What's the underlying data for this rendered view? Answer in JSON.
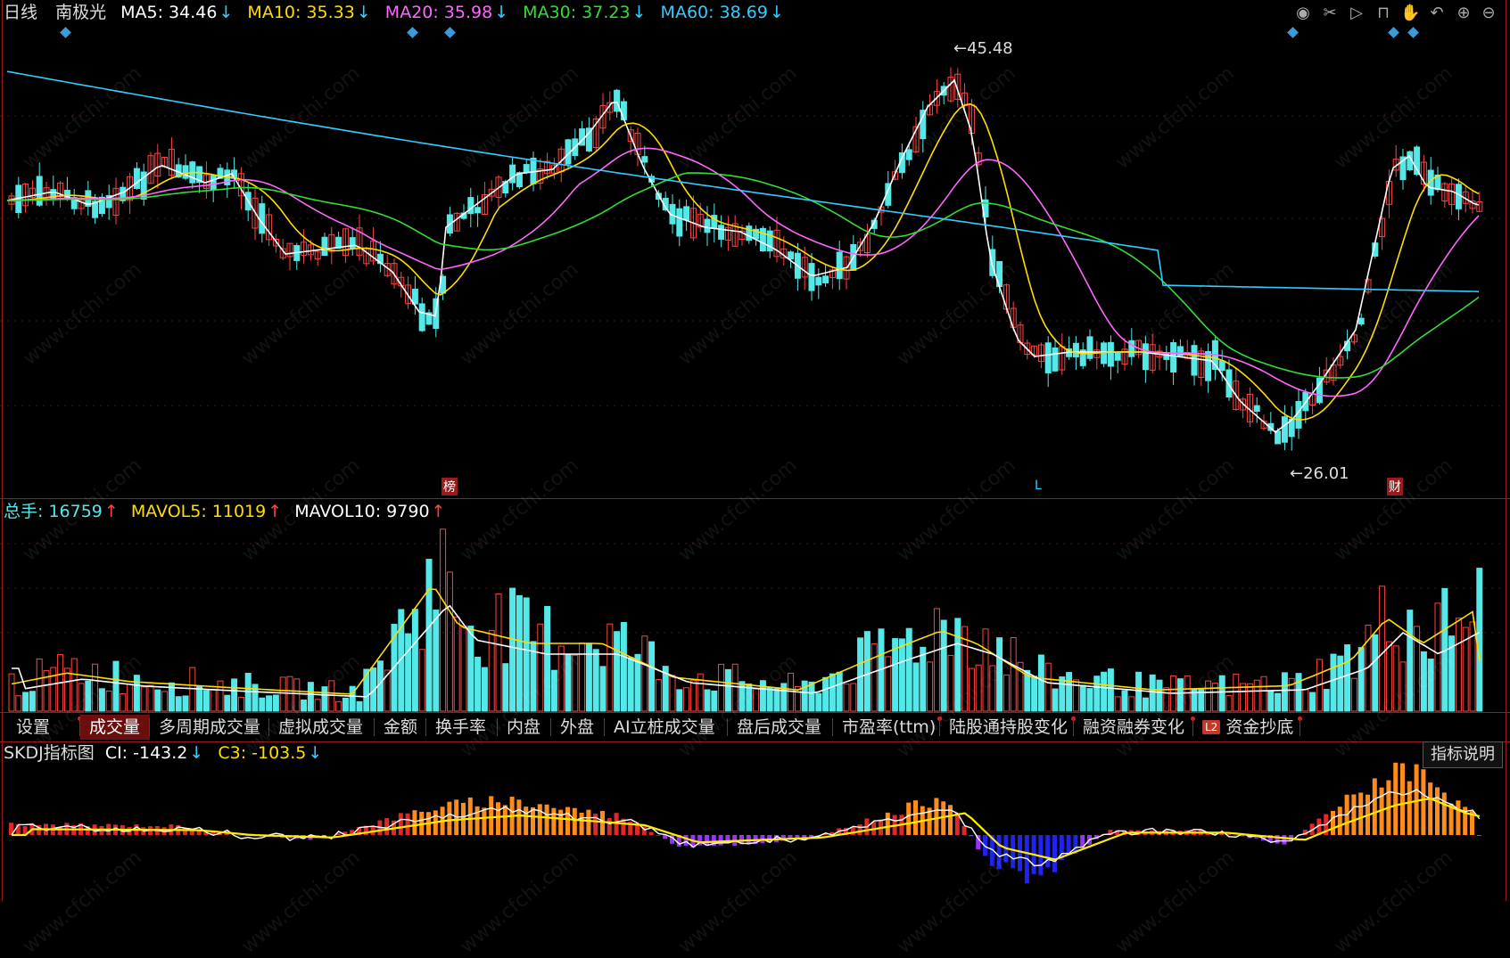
{
  "header": {
    "period": "日线",
    "stock_name": "南极光",
    "ma": [
      {
        "label": "MA5: 34.46",
        "arrow": "↓",
        "color": "#ffffff"
      },
      {
        "label": "MA10: 35.33",
        "arrow": "↓",
        "color": "#ffdd00"
      },
      {
        "label": "MA20: 35.98",
        "arrow": "↓",
        "color": "#ff66ff"
      },
      {
        "label": "MA30: 37.23",
        "arrow": "↓",
        "color": "#33dd33"
      },
      {
        "label": "MA60: 38.69",
        "arrow": "↓",
        "color": "#33ccff"
      }
    ]
  },
  "toolbar_icons": [
    "eye-icon",
    "scissors-icon",
    "play-icon",
    "lock-icon",
    "hand-icon",
    "undo-icon",
    "zoom-in-icon",
    "zoom-out-icon"
  ],
  "price_chart": {
    "high_label": "45.48",
    "low_label": "26.01",
    "markers": [
      {
        "text": "榜",
        "color": "#ffffff",
        "bg": "#9b1b1b"
      },
      {
        "text": "L",
        "color": "#33ccff",
        "bg": ""
      },
      {
        "text": "财",
        "color": "#ffffff",
        "bg": "#9b1b1b"
      }
    ]
  },
  "volume_header": {
    "total_label": "总手: 16759",
    "total_arrow": "↑",
    "mavol5": "MAVOL5: 11019",
    "mavol5_arrow": "↑",
    "mavol10": "MAVOL10: 9790",
    "mavol10_arrow": "↑"
  },
  "tabs": [
    {
      "label": "设置",
      "active": false,
      "dot": true
    },
    {
      "label": "成交量",
      "active": true,
      "dot": false
    },
    {
      "label": "多周期成交量",
      "active": false,
      "dot": false
    },
    {
      "label": "虚拟成交量",
      "active": false,
      "dot": false
    },
    {
      "label": "金额",
      "active": false,
      "dot": false
    },
    {
      "label": "换手率",
      "active": false,
      "dot": false
    },
    {
      "label": "内盘",
      "active": false,
      "dot": false
    },
    {
      "label": "外盘",
      "active": false,
      "dot": false
    },
    {
      "label": "AI立桩成交量",
      "active": false,
      "dot": false
    },
    {
      "label": "盘后成交量",
      "active": false,
      "dot": false
    },
    {
      "label": "市盈率(ttm)",
      "active": false,
      "dot": true
    },
    {
      "label": "陆股通持股变化",
      "active": false,
      "dot": true
    },
    {
      "label": "融资融券变化",
      "active": false,
      "dot": true
    },
    {
      "label": "资金抄底",
      "active": false,
      "dot": true,
      "badge": "L2"
    }
  ],
  "indicator": {
    "title": "SKDJ指标图",
    "ci": "CI: -143.2",
    "ci_arrow": "↓",
    "c3": "C3: -103.5",
    "c3_arrow": "↓",
    "explain_button": "指标说明"
  },
  "watermark": "www.cfchi.com",
  "colors": {
    "up": "#ff4444",
    "down": "#55e8e8",
    "border": "#9b1b1b"
  }
}
